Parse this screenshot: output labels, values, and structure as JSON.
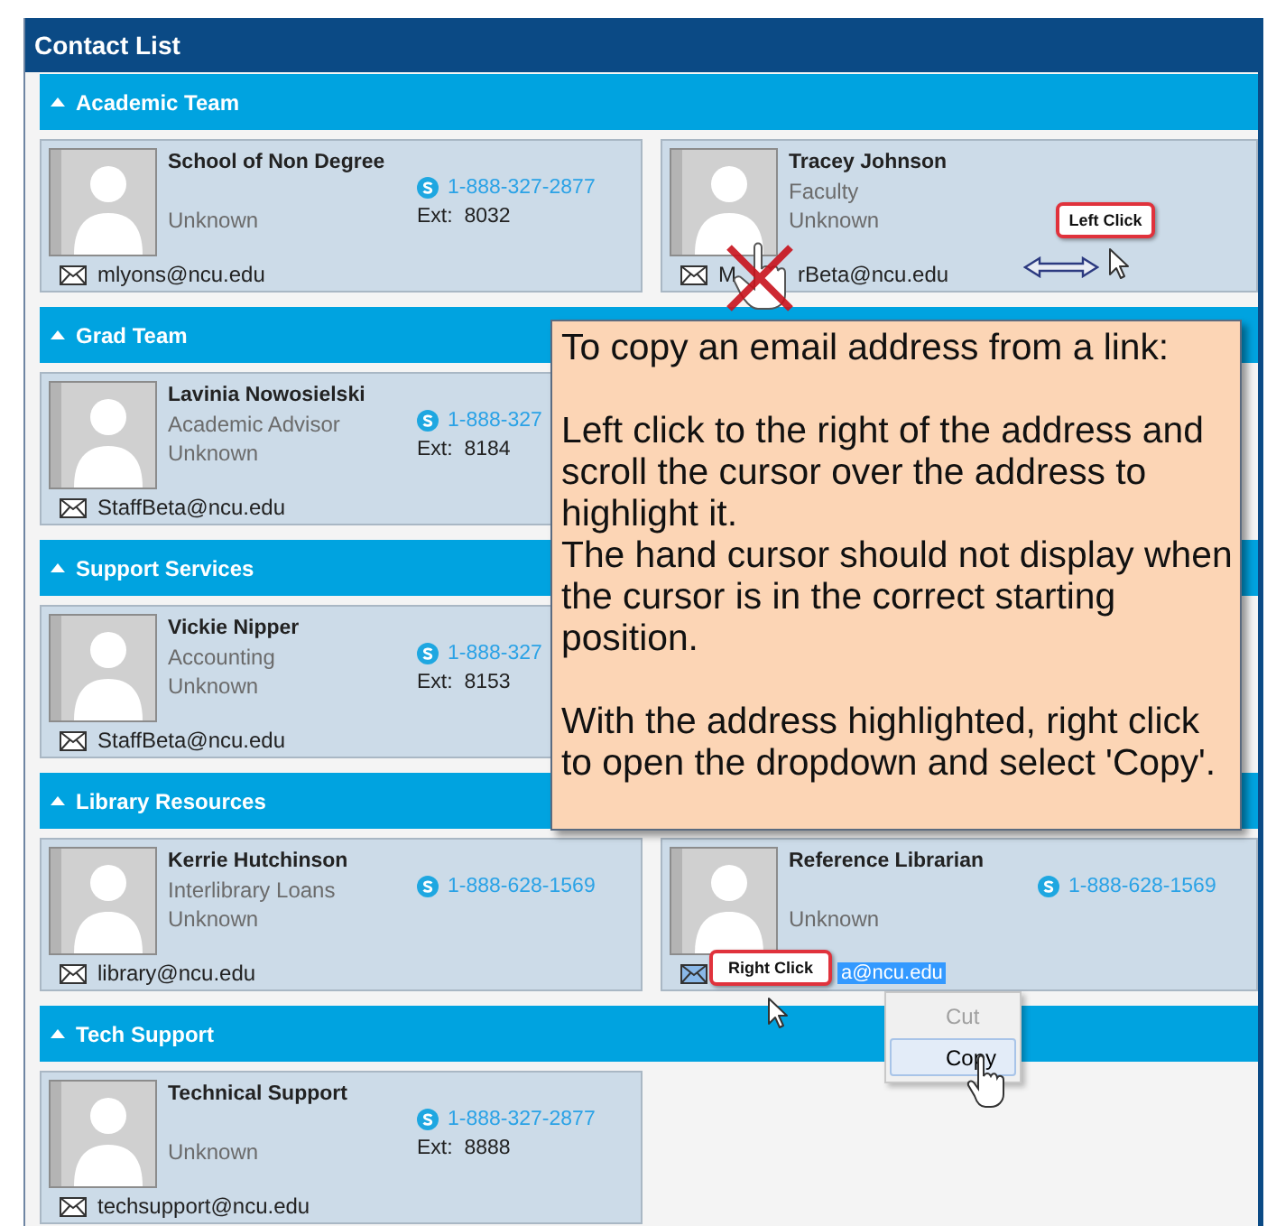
{
  "window": {
    "title": "Contact List"
  },
  "sections": [
    {
      "title": "Academic Team",
      "expanded": true,
      "contacts": [
        {
          "name": "School of Non Degree",
          "status": "Unknown",
          "phone": "1-888-327-2877",
          "ext": "Ext:  8032",
          "email": "mlyons@ncu.edu"
        },
        {
          "name": "Tracey Johnson",
          "title": "Faculty",
          "status": "Unknown",
          "email_fragments": [
            "M",
            "rBeta@ncu.edu"
          ]
        }
      ]
    },
    {
      "title": "Grad Team",
      "expanded": true,
      "contacts": [
        {
          "name": "Lavinia Nowosielski",
          "title": "Academic Advisor",
          "status": "Unknown",
          "phone": "1-888-327",
          "ext": "Ext:  8184",
          "email": "StaffBeta@ncu.edu"
        }
      ]
    },
    {
      "title": "Support Services",
      "expanded": true,
      "contacts": [
        {
          "name": "Vickie Nipper",
          "title": "Accounting",
          "status": "Unknown",
          "phone": "1-888-327",
          "ext": "Ext:  8153",
          "email": "StaffBeta@ncu.edu"
        }
      ]
    },
    {
      "title": "Library Resources",
      "expanded": true,
      "contacts": [
        {
          "name": "Kerrie Hutchinson",
          "title": "Interlibrary Loans",
          "status": "Unknown",
          "phone": "1-888-628-1569",
          "email": "library@ncu.edu"
        },
        {
          "name": "Reference Librarian",
          "status": "Unknown",
          "phone": "1-888-628-1569",
          "email": "a@ncu.edu",
          "email_selected": true
        }
      ]
    },
    {
      "title": "Tech Support",
      "expanded": true,
      "contacts": [
        {
          "name": "Technical Support",
          "status": "Unknown",
          "phone": "1-888-327-2877",
          "ext": "Ext:  8888",
          "email": "techsupport@ncu.edu"
        }
      ]
    }
  ],
  "callout": {
    "blocks": [
      [
        "To copy an email address from a link:"
      ],
      [
        "Left click to the right of the address and scroll the cursor over the address to highlight it.",
        "The hand cursor should not display when the cursor is in the correct starting position."
      ],
      [
        "With the address highlighted, right click to open the dropdown and select 'Copy'."
      ]
    ]
  },
  "left_click_bubble": {
    "label": "Left Click"
  },
  "right_click_bubble": {
    "label": "Right Click"
  },
  "context_menu": {
    "items": [
      {
        "label": "Cut",
        "disabled": true,
        "selected": false
      },
      {
        "label": "Copy",
        "disabled": false,
        "selected": true
      }
    ]
  }
}
